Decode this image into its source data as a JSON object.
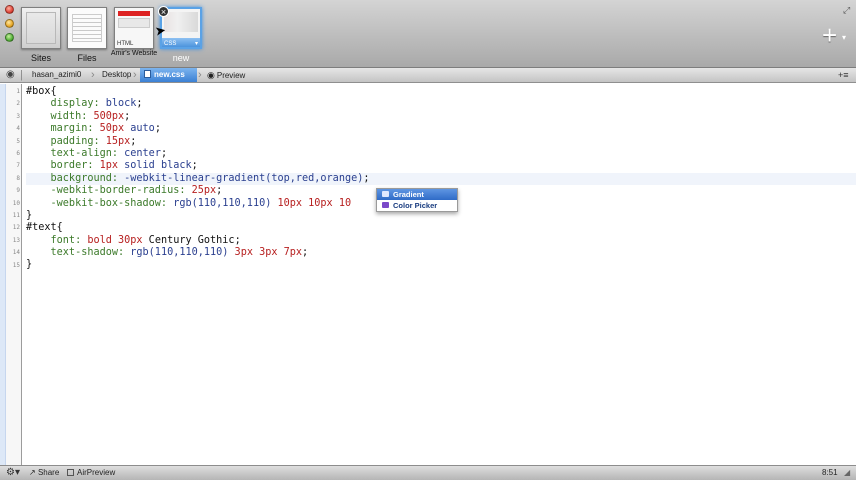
{
  "toolbar": {
    "tabs": {
      "sites": "Sites",
      "files": "Files",
      "html": "Amir's Website",
      "html_tag": "HTML",
      "css": "new",
      "css_tag": "CSS"
    },
    "add_symbol": "+"
  },
  "pathbar": {
    "user": "hasan_azimi0",
    "desktop": "Desktop",
    "file": "new.css",
    "preview": "Preview"
  },
  "editor": {
    "line_numbers": [
      "1",
      "2",
      "3",
      "4",
      "5",
      "6",
      "7",
      "8",
      "9",
      "10",
      "11",
      "12",
      "13",
      "14",
      "15"
    ],
    "code": {
      "l1_sel": "#box{",
      "l2_prop": "    display:",
      "l2_val": " block",
      "l2_end": ";",
      "l3_prop": "    width:",
      "l3_val": " 500px",
      "l3_end": ";",
      "l4_prop": "    margin:",
      "l4_val": " 50px",
      "l4_val2": " auto",
      "l4_end": ";",
      "l5_prop": "    padding:",
      "l5_val": " 15px",
      "l5_end": ";",
      "l6_prop": "    text-align:",
      "l6_val": " center",
      "l6_end": ";",
      "l7_prop": "    border:",
      "l7_val": " 1px",
      "l7_val2": " solid black",
      "l7_end": ";",
      "l8_prop": "    background:",
      "l8_val": " -webkit-linear-gradient(top,red,orange)",
      "l8_end": ";",
      "l9_prop": "    -webkit-border-radius:",
      "l9_val": " 25px",
      "l9_end": ";",
      "l10_prop": "    -webkit-box-shadow:",
      "l10_val": " rgb(110,110,110)",
      "l10_val2": " 10px 10px 10",
      "l11_sel": "}",
      "l12_sel": "#text{",
      "l13_prop": "    font:",
      "l13_val": " bold 30px",
      "l13_val2": " Century Gothic",
      "l13_end": ";",
      "l14_prop": "    text-shadow:",
      "l14_val": " rgb(110,110,110)",
      "l14_val2": " 3px 3px 7px",
      "l14_end": ";",
      "l15_sel": "}"
    },
    "autocomplete": {
      "items": [
        "Gradient",
        "Color Picker"
      ]
    }
  },
  "statusbar": {
    "share": "Share",
    "airpreview": "AirPreview",
    "time": "8:51"
  }
}
